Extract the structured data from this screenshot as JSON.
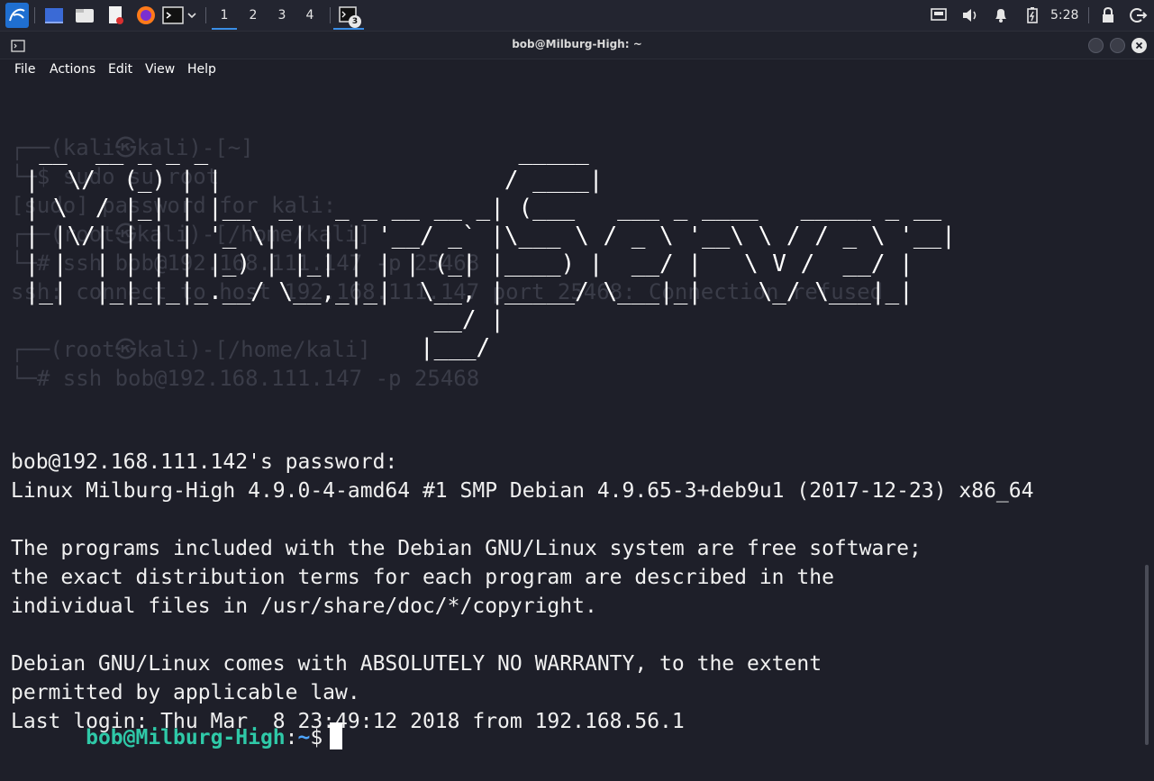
{
  "taskbar": {
    "workspaces": [
      "1",
      "2",
      "3",
      "4"
    ],
    "terminal_badge": "3",
    "clock": "5:28"
  },
  "window": {
    "title": "bob@Milburg-High: ~"
  },
  "menu": {
    "file": "File",
    "actions": "Actions",
    "edit": "Edit",
    "view": "View",
    "help": "Help"
  },
  "terminal": {
    "ghost_lines": [
      "┌──(kali㉿kali)-[~]",
      "└─$ sudo su root",
      "[sudo] password for kali:",
      "┌──(root㉿kali)-[/home/kali]",
      "└─# ssh bob@192.168.111.147 -p 25468",
      "ssh: connect to host 192.168.111.147 port 25468: Connection refused",
      "",
      "┌──(root㉿kali)-[/home/kali]",
      "└─# ssh bob@192.168.111.147 -p 25468"
    ],
    "banner_lines": [
      "  __  __ _ _ _                      _____",
      " |  \\/  (_) | |                    / ____|",
      " | \\  / |_| | |__  _   _ _ __ __ _| (___   ___ _ ____   _____ _ __",
      " | |\\/| | | | '_ \\| | | | '__/ _` |\\___ \\ / _ \\ '__\\ \\ / / _ \\ '__|",
      " | |  | | | | |_) | |_| | | | (_| |____) |  __/ |   \\ V /  __/ |",
      " |_|  |_|_|_|_.__/ \\__,_|_|  \\__, |_____/ \\___|_|    \\_/ \\___|_|",
      "                              __/ |",
      "                             |___/"
    ],
    "output_lines": [
      "",
      "bob@192.168.111.142's password:",
      "Linux Milburg-High 4.9.0-4-amd64 #1 SMP Debian 4.9.65-3+deb9u1 (2017-12-23) x86_64",
      "",
      "The programs included with the Debian GNU/Linux system are free software;",
      "the exact distribution terms for each program are described in the",
      "individual files in /usr/share/doc/*/copyright.",
      "",
      "Debian GNU/Linux comes with ABSOLUTELY NO WARRANTY, to the extent",
      "permitted by applicable law.",
      "Last login: Thu Mar  8 23:49:12 2018 from 192.168.56.1"
    ],
    "prompt": {
      "user_host": "bob@Milburg-High",
      "sep": ":",
      "path": "~",
      "symbol": "$"
    }
  },
  "colors": {
    "prompt_user": "#2fc9a8",
    "prompt_path": "#4ea5ff",
    "background": "#1e1f29"
  }
}
